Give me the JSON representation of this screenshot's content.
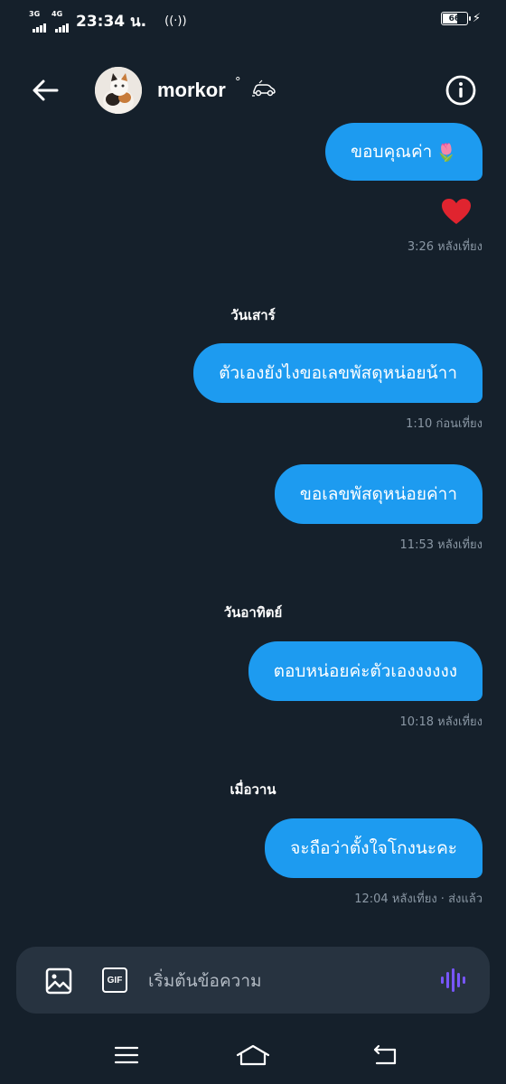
{
  "status_bar": {
    "network1": "3G",
    "network2": "4G",
    "time": "23:34 น.",
    "hotspot": "((·))",
    "battery_level": "66",
    "battery_fraction": 0.66
  },
  "header": {
    "username": "morkor",
    "username_suffix": "°",
    "emoji": "car"
  },
  "messages": [
    {
      "text": "ขอบคุณค่า",
      "emoji": "🌷"
    },
    {
      "reaction": "❤"
    },
    {
      "time": "3:26 หลังเที่ยง"
    },
    {
      "day": "วันเสาร์"
    },
    {
      "text": "ตัวเองยังไงขอเลขพัสดุหน่อยน้าา"
    },
    {
      "time": "1:10 ก่อนเที่ยง"
    },
    {
      "text": "ขอเลขพัสดุหน่อยค่าา"
    },
    {
      "time": "11:53 หลังเที่ยง"
    },
    {
      "day": "วันอาทิตย์"
    },
    {
      "text": "ตอบหน่อยค่ะตัวเองงงงงง"
    },
    {
      "time": "10:18 หลังเที่ยง"
    },
    {
      "day": "เมื่อวาน"
    },
    {
      "text": "จะถือว่าตั้งใจโกงนะคะ"
    },
    {
      "time": "12:04 หลังเที่ยง · ส่งแล้ว"
    }
  ],
  "composer": {
    "gif_label": "GIF",
    "placeholder": "เริ่มต้นข้อความ"
  },
  "colors": {
    "background": "#15202b",
    "bubble": "#1d9bf0",
    "composer": "#273340",
    "timestamp": "#8b98a5",
    "voice_accent": "#7856ff"
  }
}
